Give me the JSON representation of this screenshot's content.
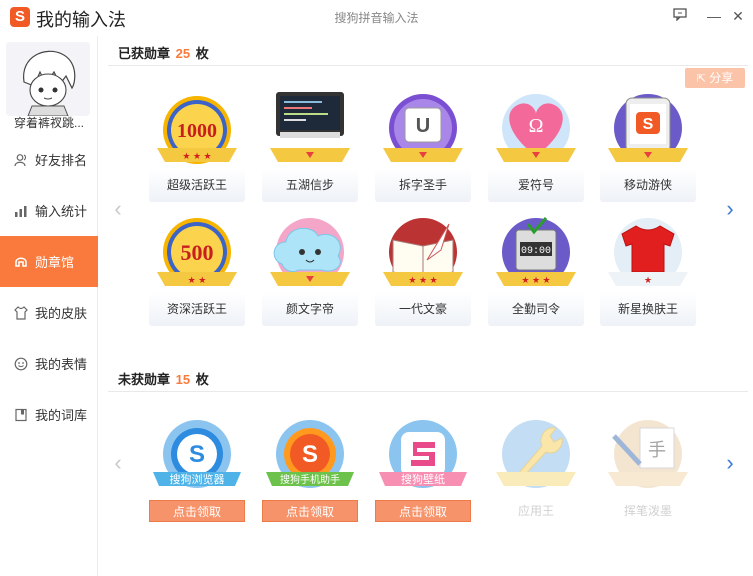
{
  "app": {
    "title": "我的输入法",
    "window_title": "搜狗拼音输入法",
    "logo_letter": "S",
    "controls": {
      "feedback": "▢",
      "minimize": "—",
      "close": "✕"
    }
  },
  "user": {
    "name": "穿着裤衩跳..."
  },
  "sidebar": {
    "items": [
      {
        "label": "好友排名",
        "icon": "friends-icon",
        "active": false
      },
      {
        "label": "输入统计",
        "icon": "stats-icon",
        "active": false
      },
      {
        "label": "勋章馆",
        "icon": "medal-icon",
        "active": true
      },
      {
        "label": "我的皮肤",
        "icon": "shirt-icon",
        "active": false
      },
      {
        "label": "我的表情",
        "icon": "smile-icon",
        "active": false
      },
      {
        "label": "我的词库",
        "icon": "dictionary-icon",
        "active": false
      }
    ]
  },
  "earned": {
    "prefix": "已获勋章",
    "count": "25",
    "suffix": "枚",
    "share_label": "分享",
    "badges": [
      {
        "label": "超级活跃王",
        "icon": "badge-1000-icon",
        "text": "1000"
      },
      {
        "label": "五湖信步",
        "icon": "badge-monitor-icon",
        "text": ""
      },
      {
        "label": "拆字圣手",
        "icon": "badge-keycap-u-icon",
        "text": "U"
      },
      {
        "label": "爱符号",
        "icon": "badge-heart-omega-icon",
        "text": "Ω"
      },
      {
        "label": "移动游侠",
        "icon": "badge-phone-icon",
        "text": "S"
      },
      {
        "label": "资深活跃王",
        "icon": "badge-500-icon",
        "text": "500"
      },
      {
        "label": "颜文字帝",
        "icon": "badge-cloud-face-icon",
        "text": ""
      },
      {
        "label": "一代文豪",
        "icon": "badge-book-quill-icon",
        "text": ""
      },
      {
        "label": "全勤司令",
        "icon": "badge-clock-icon",
        "text": "09:00"
      },
      {
        "label": "新星换肤王",
        "icon": "badge-shirt-icon",
        "text": ""
      }
    ]
  },
  "unearned": {
    "prefix": "未获勋章",
    "count": "15",
    "suffix": "枚",
    "badges": [
      {
        "banner": "搜狗浏览器",
        "icon": "badge-browser-icon",
        "action": "点击领取"
      },
      {
        "banner": "搜狗手机助手",
        "icon": "badge-phone-assistant-icon",
        "action": "点击领取"
      },
      {
        "banner": "搜狗壁纸",
        "icon": "badge-wallpaper-icon",
        "action": "点击领取"
      },
      {
        "label": "应用王",
        "icon": "badge-wrench-icon"
      },
      {
        "label": "挥笔泼墨",
        "icon": "badge-brush-icon",
        "text": "手"
      }
    ]
  },
  "colors": {
    "accent": "#f97a3c",
    "claim": "#f7936a",
    "share": "#fbc3a8",
    "ribbon": "#f5c842",
    "nav_arrow": "#3a7bd5"
  }
}
